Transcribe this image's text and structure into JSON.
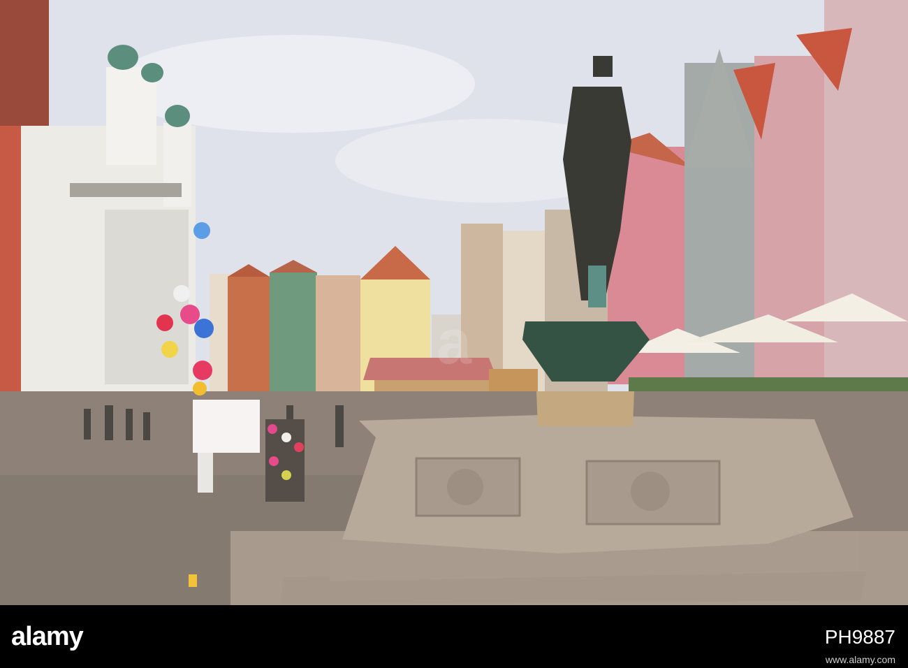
{
  "footer": {
    "brand": "alamy",
    "image_id": "PH9887",
    "stock_link": "www.alamy.com"
  },
  "palette": {
    "sky": "#dfe2ea",
    "cobblestone": "#8d8178",
    "fountain_stone": "#b8aa9a",
    "statue_bronze": "#3a3a35",
    "umbrella": "#f3efe4"
  }
}
